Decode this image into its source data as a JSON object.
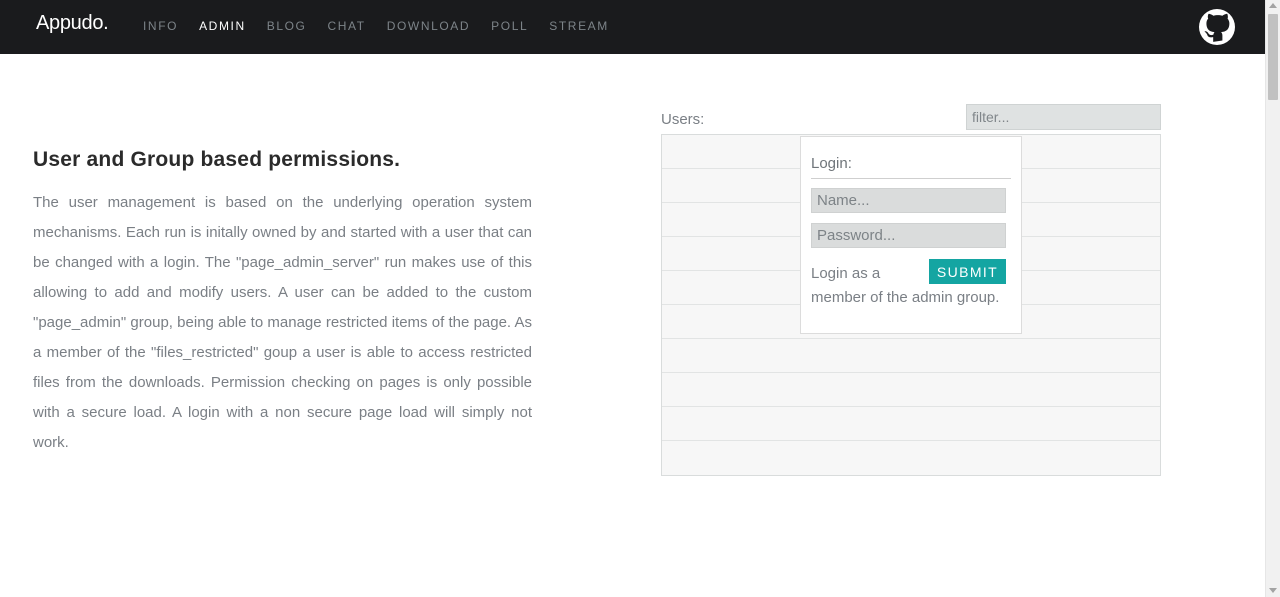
{
  "navbar": {
    "brand": "Appudo.",
    "items": [
      {
        "label": "INFO",
        "active": false
      },
      {
        "label": "ADMIN",
        "active": true
      },
      {
        "label": "BLOG",
        "active": false
      },
      {
        "label": "CHAT",
        "active": false
      },
      {
        "label": "DOWNLOAD",
        "active": false
      },
      {
        "label": "POLL",
        "active": false
      },
      {
        "label": "STREAM",
        "active": false
      }
    ],
    "github_icon": "github-icon"
  },
  "section": {
    "title": "User and Group based permissions.",
    "text": "The user management is based on the underlying operation system mechanisms. Each run is initally owned by and started with a user that can be changed with a login. The \"page_admin_server\" run makes use of this allowing to add and modify users. A user can be added to the custom \"page_admin\" group, being able to manage restricted items of the page. As a member of the \"files_restricted\" goup a user is able to access restricted files from the downloads. Permission checking on pages is only possible with a secure load. A login with a non secure page load will simply not work."
  },
  "users": {
    "label": "Users:",
    "filter_placeholder": "filter...",
    "rows": [
      "",
      "",
      "",
      "",
      "",
      "",
      "",
      "",
      "",
      ""
    ]
  },
  "login": {
    "title": "Login:",
    "name_placeholder": "Name...",
    "password_placeholder": "Password...",
    "submit_label": "SUBMIT",
    "note": "Login as a member of the admin group."
  },
  "colors": {
    "navbar_bg": "#1a1b1d",
    "accent": "#14a5a2"
  }
}
